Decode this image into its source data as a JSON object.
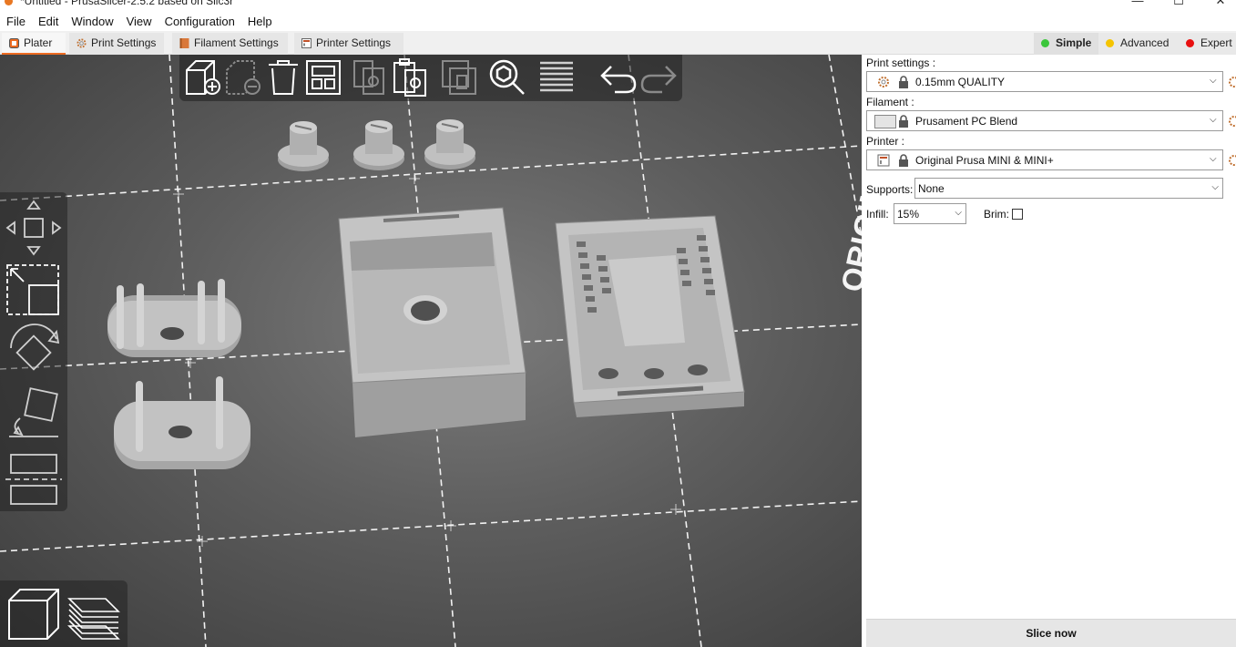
{
  "window": {
    "title": "*Untitled - PrusaSlicer-2.5.2 based on Slic3r",
    "controls": {
      "minimize": "—",
      "maximize": "☐",
      "close": "✕"
    }
  },
  "menu": [
    "File",
    "Edit",
    "Window",
    "View",
    "Configuration",
    "Help"
  ],
  "tabs": [
    {
      "label": "Plater",
      "icon": "plater-icon",
      "active": true
    },
    {
      "label": "Print Settings",
      "icon": "gear-icon",
      "active": false
    },
    {
      "label": "Filament Settings",
      "icon": "spool-icon",
      "active": false
    },
    {
      "label": "Printer Settings",
      "icon": "printer-icon",
      "active": false
    }
  ],
  "modes": [
    {
      "label": "Simple",
      "color": "#3bc63b",
      "active": true
    },
    {
      "label": "Advanced",
      "color": "#f5c400",
      "active": false
    },
    {
      "label": "Expert",
      "color": "#e81010",
      "active": false
    }
  ],
  "viewport": {
    "bed_logo_text": "ORIGINAL PRUSA M",
    "top_toolbar_icons": [
      "add-icon",
      "delete-icon",
      "delete-all-icon",
      "arrange-icon",
      "copy-icon",
      "paste-icon",
      "instances-icon",
      "search-icon",
      "layers-editing-icon",
      "undo-icon",
      "redo-icon"
    ],
    "left_toolbar_icons": [
      "move-icon",
      "scale-icon",
      "rotate-icon",
      "place-on-face-icon",
      "cut-icon"
    ],
    "view_toggle_icons": [
      "3d-view-icon",
      "preview-layers-icon"
    ]
  },
  "sidebar": {
    "print_settings": {
      "label": "Print settings :",
      "value": "0.15mm QUALITY"
    },
    "filament": {
      "label": "Filament :",
      "value": "Prusament PC Blend",
      "swatch_color": "#e4e4e4"
    },
    "printer": {
      "label": "Printer :",
      "value": "Original Prusa MINI & MINI+"
    },
    "supports": {
      "label": "Supports:",
      "value": "None"
    },
    "infill": {
      "label": "Infill:",
      "value": "15%"
    },
    "brim": {
      "label": "Brim:",
      "checked": false
    },
    "slice_button": "Slice now"
  },
  "colors": {
    "accent": "#ed6b21",
    "model_gray": "#b4b4b4"
  }
}
